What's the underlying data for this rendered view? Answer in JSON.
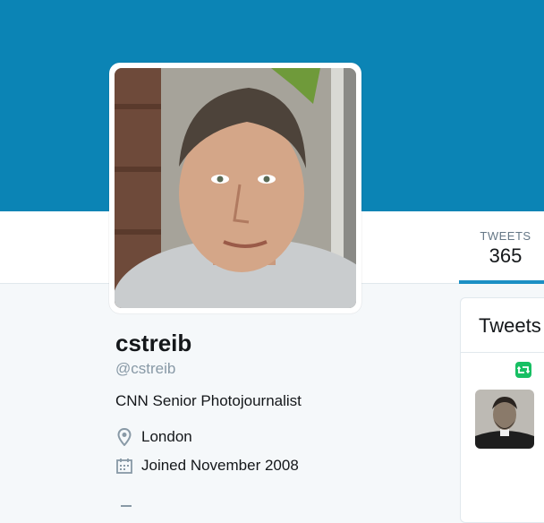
{
  "profile": {
    "name": "cstreib",
    "handle": "@cstreib",
    "bio": "CNN Senior Photojournalist",
    "location": "London",
    "joined": "Joined November 2008"
  },
  "nav": {
    "tweets_label": "TWEETS",
    "tweets_count": "365"
  },
  "timeline": {
    "heading": "Tweets"
  },
  "icons": {
    "location": "map-pin-icon",
    "joined": "calendar-icon",
    "retweet": "retweet-icon"
  },
  "colors": {
    "banner": "#0b84b5",
    "accent": "#1b8fc4",
    "retweet": "#17bf63",
    "muted": "#8899a6"
  }
}
